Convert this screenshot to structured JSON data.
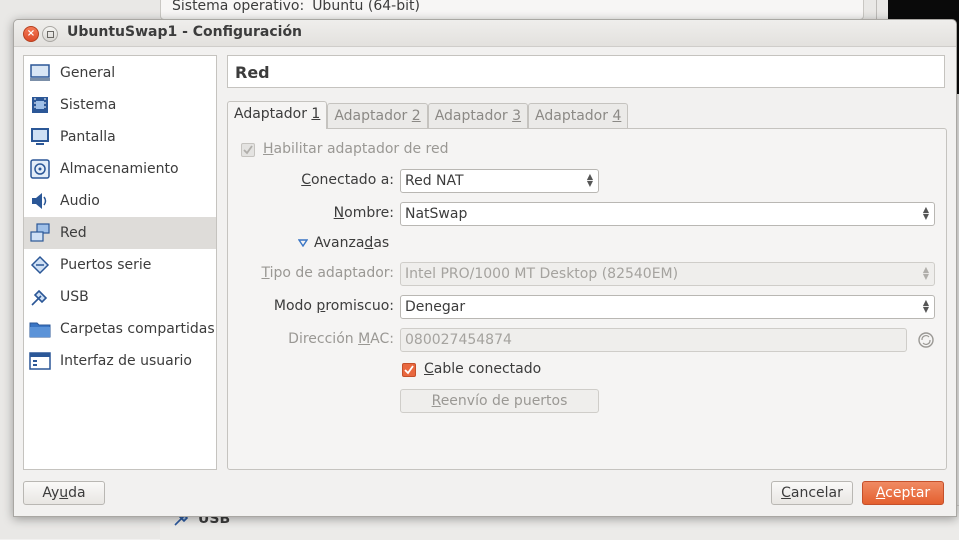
{
  "background": {
    "os_label": "Sistema operativo:",
    "os_value": "Ubuntu (64-bit)",
    "usb_label": "USB"
  },
  "dialog": {
    "title": "UbuntuSwap1 - Configuración",
    "close_glyph": "×"
  },
  "sidebar": {
    "items": [
      {
        "label": "General",
        "icon": "general-icon"
      },
      {
        "label": "Sistema",
        "icon": "chip-icon"
      },
      {
        "label": "Pantalla",
        "icon": "monitor-icon"
      },
      {
        "label": "Almacenamiento",
        "icon": "disk-icon"
      },
      {
        "label": "Audio",
        "icon": "speaker-icon"
      },
      {
        "label": "Red",
        "icon": "network-icon",
        "selected": true
      },
      {
        "label": "Puertos serie",
        "icon": "serial-port-icon"
      },
      {
        "label": "USB",
        "icon": "usb-icon"
      },
      {
        "label": "Carpetas compartidas",
        "icon": "folder-icon"
      },
      {
        "label": "Interfaz de usuario",
        "icon": "window-icon"
      }
    ]
  },
  "page": {
    "title": "Red",
    "tabs": [
      {
        "pre": "Adaptador ",
        "key": "1",
        "active": true
      },
      {
        "pre": "Adaptador ",
        "key": "2"
      },
      {
        "pre": "Adaptador ",
        "key": "3"
      },
      {
        "pre": "Adaptador ",
        "key": "4"
      }
    ],
    "enable_label_key": "H",
    "enable_label_rest": "abilitar adaptador de red",
    "attached": {
      "key": "C",
      "rest": "onectado a:",
      "value": "Red NAT"
    },
    "name": {
      "key": "N",
      "rest": "ombre:",
      "value": "NatSwap"
    },
    "advanced": {
      "pre": "Avanza",
      "key": "d",
      "post": "as"
    },
    "adapter_type": {
      "key": "T",
      "rest": "ipo de adaptador:",
      "value": "Intel PRO/1000 MT Desktop (82540EM)"
    },
    "promiscuous": {
      "pre": "Modo ",
      "key": "p",
      "post": "romiscuo:",
      "value": "Denegar"
    },
    "mac": {
      "pre": "Dirección ",
      "key": "M",
      "post": "AC:",
      "value": "080027454874"
    },
    "cable": {
      "key": "C",
      "rest": "able conectado",
      "checked": true
    },
    "port_forward": {
      "key": "R",
      "rest": "eenvío de puertos"
    }
  },
  "footer": {
    "help": {
      "pre": "Ay",
      "key": "u",
      "post": "da"
    },
    "cancel": {
      "key": "C",
      "rest": "ancelar"
    },
    "accept": {
      "key": "A",
      "rest": "ceptar"
    }
  },
  "colors": {
    "accent": "#e9683f",
    "selected_bg": "#dedcd9"
  }
}
